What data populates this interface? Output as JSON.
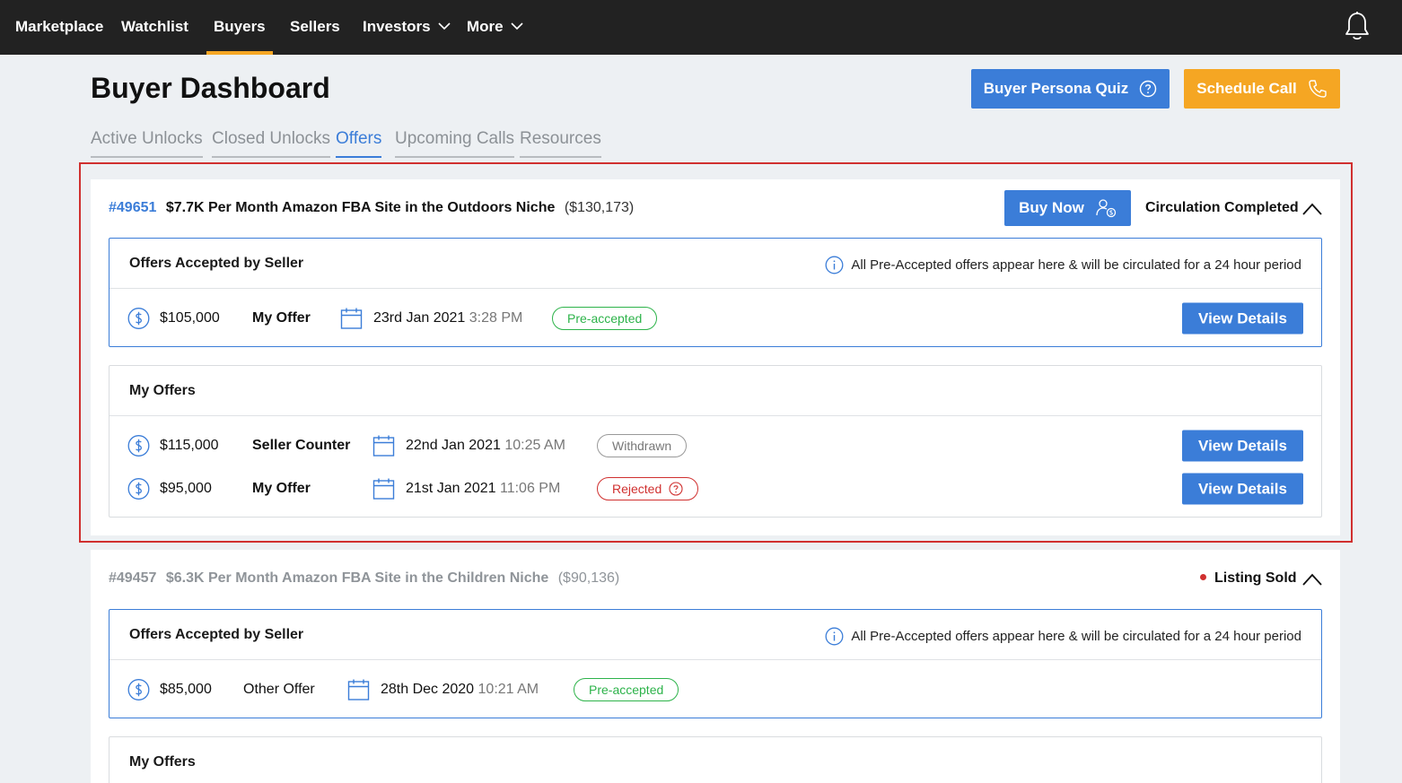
{
  "nav": {
    "items": [
      {
        "label": "Marketplace"
      },
      {
        "label": "Watchlist"
      },
      {
        "label": "Buyers"
      },
      {
        "label": "Sellers"
      },
      {
        "label": "Investors"
      },
      {
        "label": "More"
      }
    ],
    "active": "Buyers",
    "icons": {
      "dropdown": "chevron-down-icon",
      "notifications": "bell-icon"
    }
  },
  "header": {
    "title": "Buyer Dashboard",
    "quiz_button": "Buyer Persona Quiz",
    "quiz_icon": "question-circle-icon",
    "call_button": "Schedule Call",
    "call_icon": "phone-icon"
  },
  "tabs": [
    {
      "label": "Active Unlocks"
    },
    {
      "label": "Closed Unlocks"
    },
    {
      "label": "Offers"
    },
    {
      "label": "Upcoming Calls"
    },
    {
      "label": "Resources"
    }
  ],
  "active_tab": "Offers",
  "listings": [
    {
      "id": "#49651",
      "title": "$7.7K Per Month Amazon FBA Site in the Outdoors Niche",
      "price": "($130,173)",
      "buy_now": "Buy Now",
      "status": "Circulation Completed",
      "accepted_section": {
        "title": "Offers Accepted by Seller",
        "note": "All Pre-Accepted offers appear here & will be circulated for a 24 hour period",
        "offers": [
          {
            "amount": "$105,000",
            "type": "My Offer",
            "date": "23rd Jan 2021",
            "time": "3:28 PM",
            "badge": "Pre-accepted",
            "action": "View Details"
          }
        ]
      },
      "my_offers_section": {
        "title": "My Offers",
        "offers": [
          {
            "amount": "$115,000",
            "type": "Seller Counter",
            "date": "22nd Jan 2021",
            "time": "10:25 AM",
            "badge": "Withdrawn",
            "action": "View Details"
          },
          {
            "amount": "$95,000",
            "type": "My Offer",
            "date": "21st Jan 2021",
            "time": "11:06 PM",
            "badge": "Rejected",
            "action": "View Details"
          }
        ]
      }
    },
    {
      "id": "#49457",
      "title": "$6.3K Per Month Amazon FBA Site in the Children Niche",
      "price": "($90,136)",
      "status": "Listing Sold",
      "accepted_section": {
        "title": "Offers Accepted by Seller",
        "note": "All Pre-Accepted offers appear here & will be circulated for a 24 hour period",
        "offers": [
          {
            "amount": "$85,000",
            "type": "Other Offer",
            "date": "28th Dec 2020",
            "time": "10:21 AM",
            "badge": "Pre-accepted"
          }
        ]
      },
      "my_offers_section": {
        "title": "My Offers"
      }
    }
  ],
  "colors": {
    "accent_blue": "#3b7dd8",
    "accent_orange": "#f5a623",
    "nav_bg": "#222222",
    "success": "#2db34a",
    "danger": "#d0302f"
  }
}
